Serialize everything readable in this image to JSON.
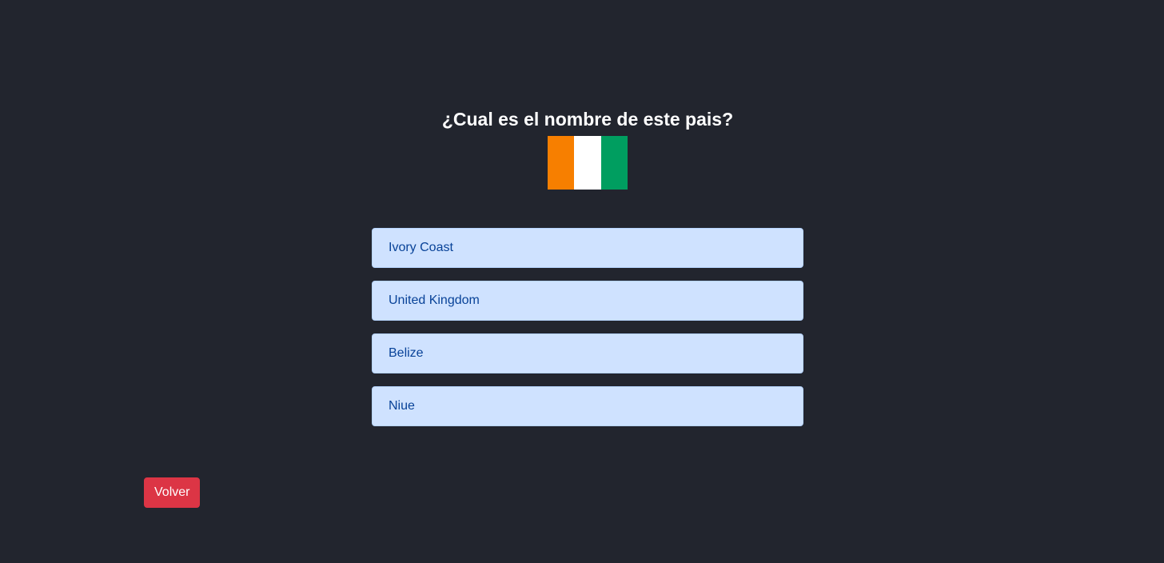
{
  "quiz": {
    "question": "¿Cual es el nombre de este pais?",
    "flag": {
      "colors": [
        "#f77f00",
        "#ffffff",
        "#009e60"
      ]
    },
    "options": [
      {
        "label": "Ivory Coast"
      },
      {
        "label": "United Kingdom"
      },
      {
        "label": "Belize"
      },
      {
        "label": "Niue"
      }
    ]
  },
  "actions": {
    "back_label": "Volver"
  },
  "colors": {
    "background": "#22252e",
    "option_bg": "#cfe2ff",
    "option_text": "#084298",
    "danger": "#dc3545"
  }
}
